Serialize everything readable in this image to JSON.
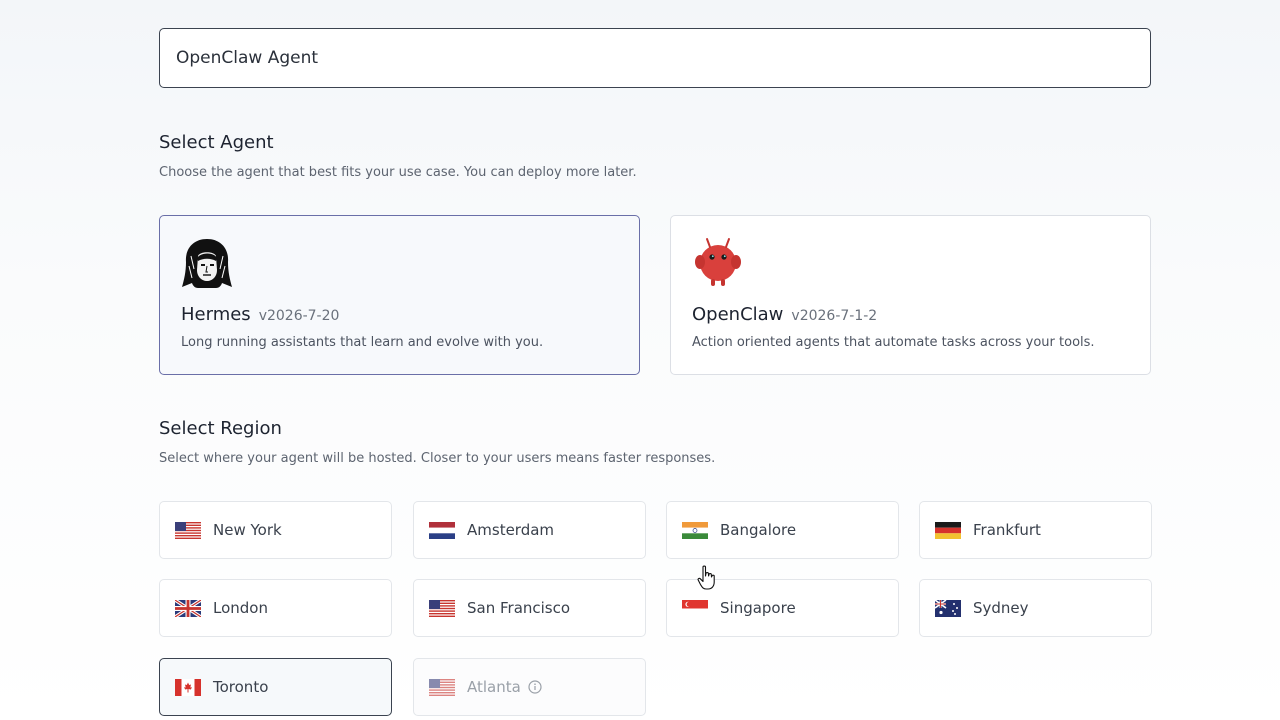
{
  "agent_name_input": {
    "value": "OpenClaw Agent"
  },
  "select_agent": {
    "title": "Select Agent",
    "subtitle": "Choose the agent that best fits your use case. You can deploy more later.",
    "agents": [
      {
        "name": "Hermes",
        "version": "v2026-7-20",
        "description": "Long running assistants that learn and evolve with you.",
        "icon": "hermes-avatar-icon",
        "selected": true
      },
      {
        "name": "OpenClaw",
        "version": "v2026-7-1-2",
        "description": "Action oriented agents that automate tasks across your tools.",
        "icon": "openclaw-mascot-icon",
        "selected": false
      }
    ]
  },
  "select_region": {
    "title": "Select Region",
    "subtitle": "Select where your agent will be hosted. Closer to your users means faster responses.",
    "regions": [
      {
        "name": "New York",
        "flag": "us-flag-icon"
      },
      {
        "name": "Amsterdam",
        "flag": "netherlands-flag-icon"
      },
      {
        "name": "Bangalore",
        "flag": "india-flag-icon"
      },
      {
        "name": "Frankfurt",
        "flag": "germany-flag-icon"
      },
      {
        "name": "London",
        "flag": "uk-flag-icon"
      },
      {
        "name": "San Francisco",
        "flag": "us-flag-icon"
      },
      {
        "name": "Singapore",
        "flag": "singapore-flag-icon"
      },
      {
        "name": "Sydney",
        "flag": "australia-flag-icon"
      },
      {
        "name": "Toronto",
        "flag": "canada-flag-icon",
        "selected": true
      },
      {
        "name": "Atlanta",
        "flag": "us-flag-icon",
        "disabled": true,
        "info_icon": "info-icon"
      }
    ]
  },
  "colors": {
    "selected_agent_border": "#6a6fa8",
    "selected_region_border": "#3b4350",
    "openclaw_red": "#d9403c"
  }
}
